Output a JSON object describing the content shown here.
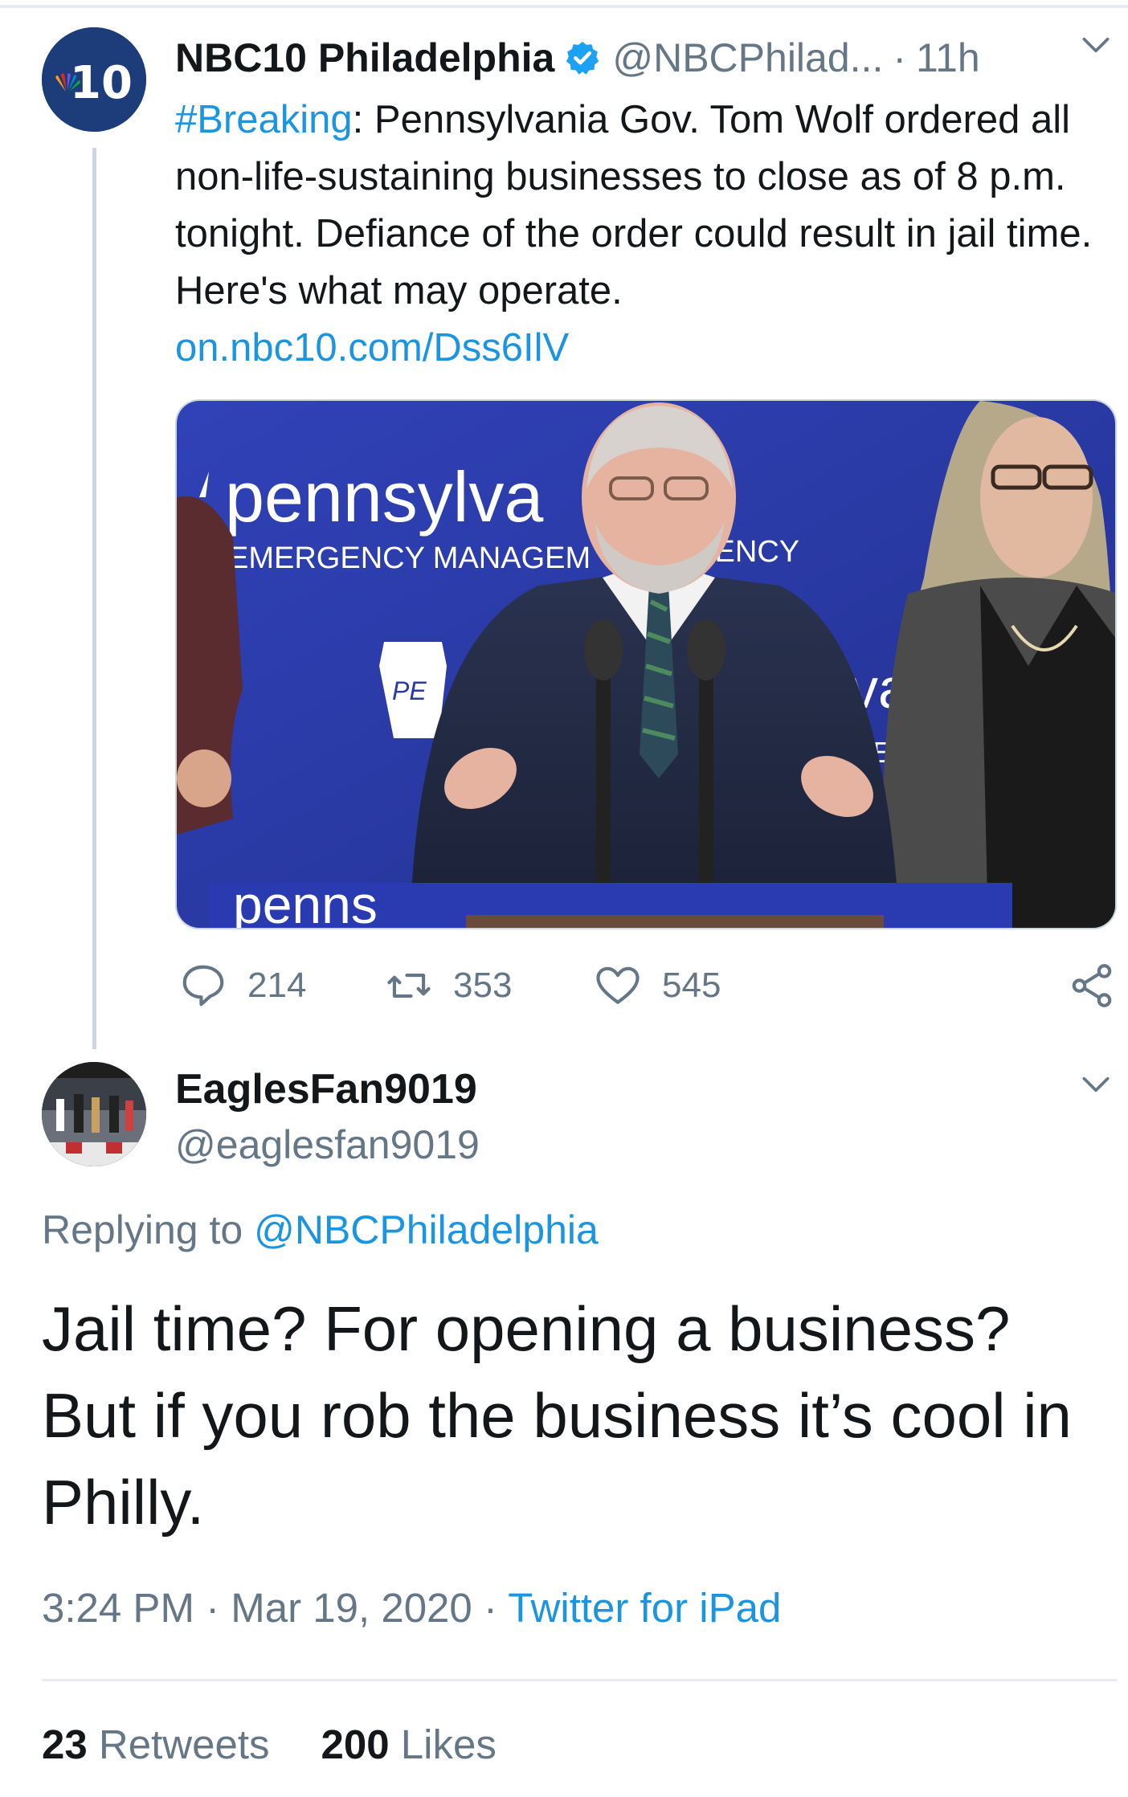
{
  "tweet": {
    "display_name": "NBC10 Philadelphia",
    "handle": "@NBCPhilad...",
    "separator": "·",
    "time": "11h",
    "avatar_text": "10",
    "text_hashtag": "#Breaking",
    "text_body": ": Pennsylvania Gov. Tom Wolf ordered all non-life-sustaining businesses to close as of 8 p.m. tonight. Defiance of the order could result in jail time. Here's what may operate.",
    "link": "on.nbc10.com/Dss6IlV",
    "media": {
      "banner_big": "pennsylva",
      "banner_small": "EMERGENCY MANAGEM",
      "banner_small_2": "GENCY",
      "seal_text": "PE",
      "banner_right": "va",
      "banner_right_small": "GE",
      "podium_text": "penns"
    },
    "actions": {
      "replies": "214",
      "retweets": "353",
      "likes": "545"
    }
  },
  "reply": {
    "display_name": "EaglesFan9019",
    "handle": "@eaglesfan9019",
    "replying_prefix": "Replying to",
    "replying_mention": "@NBCPhiladelphia",
    "body": "Jail time? For opening a business? But if you rob the business it’s cool in Philly.",
    "time": "3:24 PM",
    "dot": "·",
    "date": "Mar 19, 2020",
    "source": "Twitter for iPad",
    "retweet_count": "23",
    "retweet_label": "Retweets",
    "like_count": "200",
    "like_label": "Likes"
  },
  "colors": {
    "link": "#1b95e0",
    "muted": "#657786",
    "text": "#14171a",
    "divider": "#e6ecf0",
    "nbc_blue": "#1d3c7a",
    "backdrop_blue": "#2b3aa6"
  },
  "icons": [
    "verified-badge-icon",
    "chevron-down-icon",
    "reply-icon",
    "retweet-icon",
    "like-icon",
    "share-icon",
    "nbc-peacock-icon"
  ]
}
